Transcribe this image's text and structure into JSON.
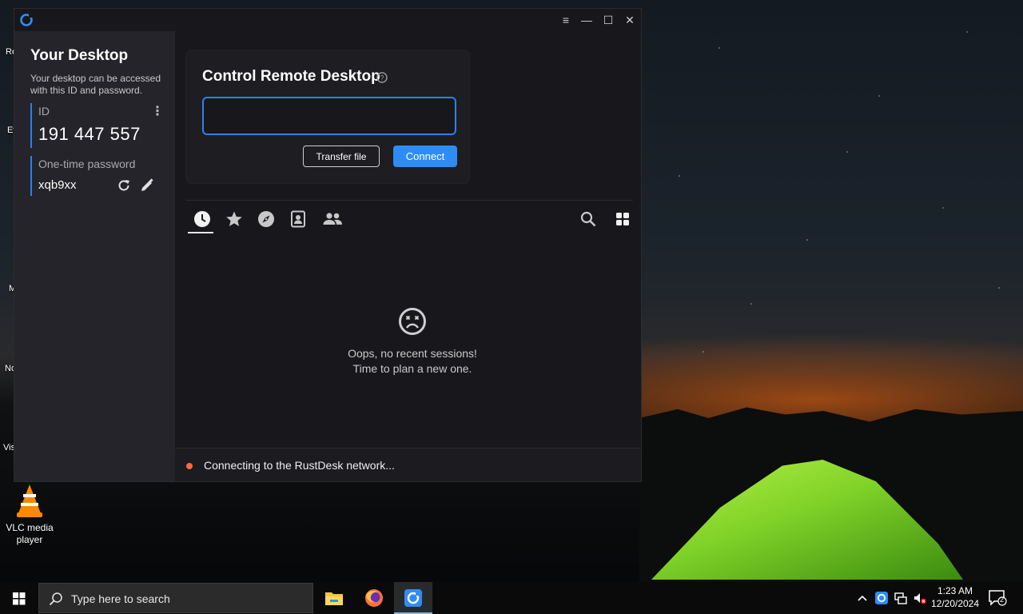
{
  "desktop": {
    "icons": [
      {
        "label": "Re"
      },
      {
        "label": "Ev"
      },
      {
        "label": "M"
      },
      {
        "label": "No"
      },
      {
        "label": "Vis"
      }
    ],
    "vlc_label_line1": "VLC media",
    "vlc_label_line2": "player"
  },
  "window": {
    "controls": {
      "menu": "≡",
      "minimize": "—",
      "maximize": "☐",
      "close": "✕"
    }
  },
  "sidebar": {
    "title": "Your Desktop",
    "description": "Your desktop can be accessed with this ID and password.",
    "id_label": "ID",
    "id_value": "191 447 557",
    "password_label": "One-time password",
    "password_value": "xqb9xx"
  },
  "main": {
    "card_title": "Control Remote Desktop",
    "id_input_value": "",
    "transfer_file_label": "Transfer file",
    "connect_label": "Connect",
    "tabs": [
      "recent-sessions",
      "favorites",
      "discovered",
      "address-book",
      "group"
    ],
    "active_tab": "recent-sessions",
    "empty_line1": "Oops, no recent sessions!",
    "empty_line2": "Time to plan a new one.",
    "status_text": "Connecting to the RustDesk network..."
  },
  "taskbar": {
    "search_placeholder": "Type here to search",
    "clock_time": "1:23 AM",
    "clock_date": "12/20/2024",
    "notification_count": "2"
  },
  "colors": {
    "accent": "#2e8df5",
    "status_dot": "#ff6a3d",
    "window_bg": "#18181c",
    "sidebar_bg": "#24242a"
  }
}
